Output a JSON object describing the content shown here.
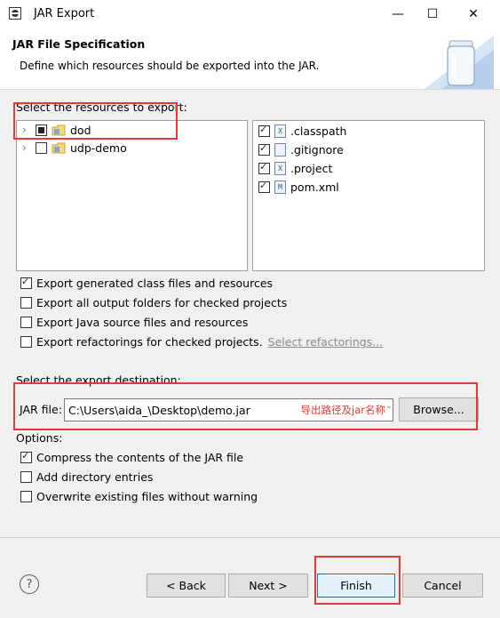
{
  "window": {
    "title": "JAR Export",
    "minimize": "—",
    "maximize": "☐",
    "close": "✕"
  },
  "header": {
    "title": "JAR File Specification",
    "description": "Define which resources should be exported into the JAR."
  },
  "resources": {
    "label": "Select the resources to export:",
    "projects": [
      {
        "name": "dod",
        "state": "partial"
      },
      {
        "name": "udp-demo",
        "state": "unchecked"
      }
    ],
    "files": [
      {
        "name": ".classpath",
        "icon": "X",
        "checked": true
      },
      {
        "name": ".gitignore",
        "icon": "",
        "checked": true
      },
      {
        "name": ".project",
        "icon": "X",
        "checked": true
      },
      {
        "name": "pom.xml",
        "icon": "M",
        "checked": true
      }
    ]
  },
  "export_options": [
    {
      "label": "Export generated class files and resources",
      "checked": true
    },
    {
      "label": "Export all output folders for checked projects",
      "checked": false
    },
    {
      "label": "Export Java source files and resources",
      "checked": false
    },
    {
      "label": "Export refactorings for checked projects.",
      "checked": false
    }
  ],
  "select_refactorings": "Select refactorings...",
  "destination": {
    "label": "Select the export destination:",
    "jar_file_label": "JAR file:",
    "jar_file_value": "C:\\Users\\aida_\\Desktop\\demo.jar",
    "annotation": "导出路径及jar名称",
    "browse": "Browse..."
  },
  "options": {
    "label": "Options:",
    "items": [
      {
        "label": "Compress the contents of the JAR file",
        "checked": true
      },
      {
        "label": "Add directory entries",
        "checked": false
      },
      {
        "label": "Overwrite existing files without warning",
        "checked": false
      }
    ]
  },
  "buttons": {
    "help": "?",
    "back": "< Back",
    "next": "Next >",
    "finish": "Finish",
    "cancel": "Cancel"
  },
  "colors": {
    "annotation_red": "#e53935",
    "finish_border": "#0078d7"
  }
}
